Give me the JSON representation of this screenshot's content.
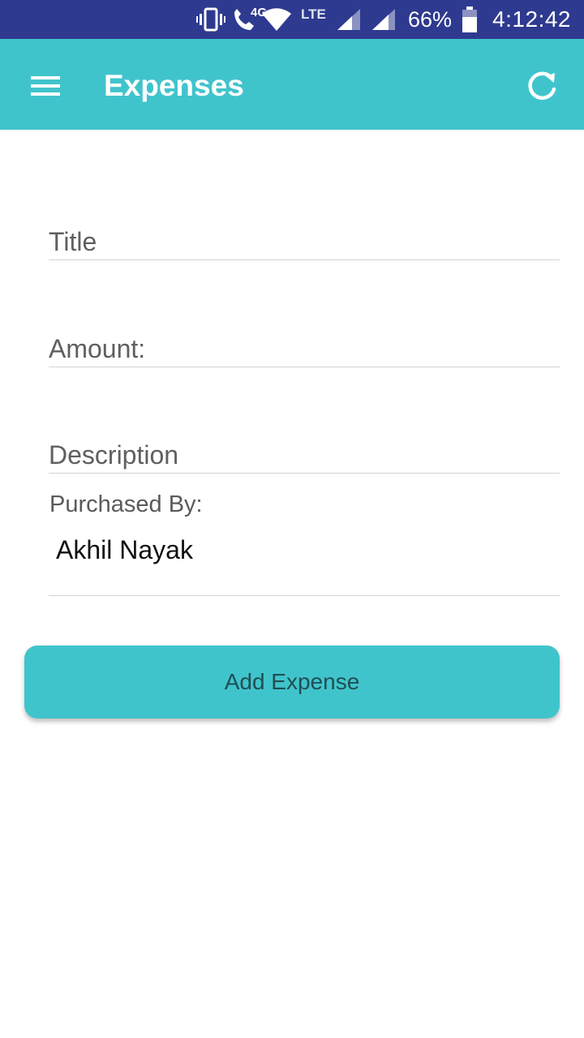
{
  "status_bar": {
    "network_type": "4G",
    "lte_label": "LTE",
    "battery_percent": "66%",
    "time": "4:12:42",
    "icons": [
      "vibrate-icon",
      "volte-call-icon",
      "wifi-icon",
      "signal-icon",
      "signal-icon",
      "battery-icon"
    ]
  },
  "app_bar": {
    "title": "Expenses",
    "menu_icon": "menu-icon",
    "refresh_icon": "refresh-icon",
    "color": "#40c4cc"
  },
  "form": {
    "title_field": {
      "placeholder": "Title",
      "value": ""
    },
    "amount_field": {
      "placeholder": "Amount:",
      "value": ""
    },
    "description_field": {
      "placeholder": "Description",
      "value": ""
    },
    "purchased_by_label": "Purchased By:",
    "purchased_by_value": "Akhil Nayak"
  },
  "button": {
    "label": "Add Expense",
    "color": "#40c4cc"
  },
  "colors": {
    "status_bar": "#2e3a8f",
    "accent": "#40c4cc"
  }
}
